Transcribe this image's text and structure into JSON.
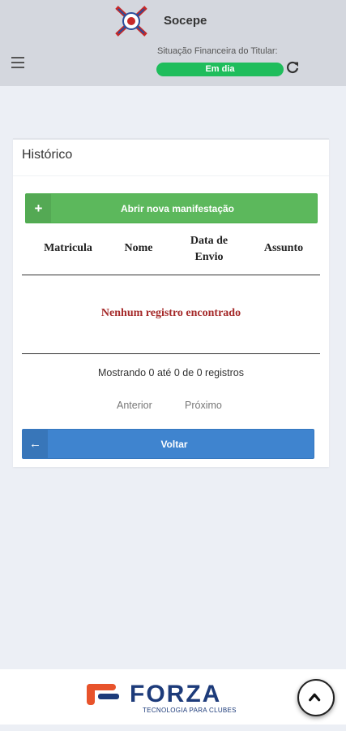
{
  "header": {
    "club_name": "Socepe",
    "financial_label": "Situação Financeira do Titular:",
    "financial_status": "Em dia",
    "status_color": "#1fbd5c",
    "menu_icon": "hamburger-icon",
    "refresh_icon": "refresh-icon"
  },
  "card": {
    "title": "Histórico",
    "new_button_icon": "+",
    "new_button_label": "Abrir nova manifestação",
    "table": {
      "columns": [
        "Matricula",
        "Nome",
        "Data de Envio",
        "Assunto"
      ],
      "rows": [],
      "empty_message": "Nenhum registro encontrado"
    },
    "info": "Mostrando 0 até 0 de 0 registros",
    "pager": {
      "previous": "Anterior",
      "next": "Próximo"
    },
    "back_button_icon": "←",
    "back_button_label": "Voltar"
  },
  "footer": {
    "brand": "FORZA",
    "tagline": "TECNOLOGIA PARA CLUBES",
    "scroll_top_icon": "chevron-up-icon"
  },
  "colors": {
    "success": "#5cb85c",
    "primary": "#3f84cf",
    "empty_text": "#a52a2a",
    "brand_blue": "#1d3b7a",
    "brand_orange": "#e8532b"
  }
}
